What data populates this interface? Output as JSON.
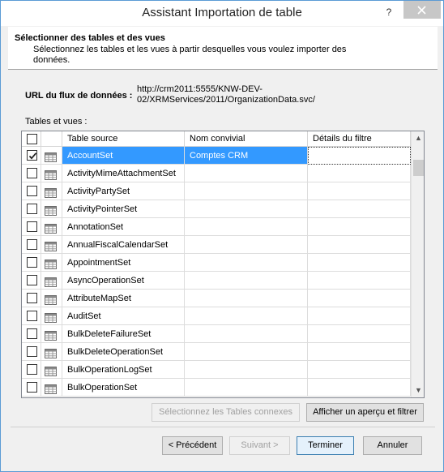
{
  "window": {
    "title": "Assistant Importation de table",
    "help_glyph": "?"
  },
  "header": {
    "title": "Sélectionner des tables et des vues",
    "description": "Sélectionnez les tables et les vues à partir desquelles vous voulez importer des données."
  },
  "url": {
    "label": "URL du flux de données :",
    "value": "http://crm2011:5555/KNW-DEV-02/XRMServices/2011/OrganizationData.svc/"
  },
  "tables": {
    "label": "Tables et vues :",
    "columns": [
      "Table source",
      "Nom convivial",
      "Détails du filtre"
    ],
    "rows": [
      {
        "source": "AccountSet",
        "friendly": "Comptes CRM",
        "filter": "",
        "checked": true,
        "selected": true
      },
      {
        "source": "ActivityMimeAttachmentSet",
        "friendly": "",
        "filter": "",
        "checked": false
      },
      {
        "source": "ActivityPartySet",
        "friendly": "",
        "filter": "",
        "checked": false
      },
      {
        "source": "ActivityPointerSet",
        "friendly": "",
        "filter": "",
        "checked": false
      },
      {
        "source": "AnnotationSet",
        "friendly": "",
        "filter": "",
        "checked": false
      },
      {
        "source": "AnnualFiscalCalendarSet",
        "friendly": "",
        "filter": "",
        "checked": false
      },
      {
        "source": "AppointmentSet",
        "friendly": "",
        "filter": "",
        "checked": false
      },
      {
        "source": "AsyncOperationSet",
        "friendly": "",
        "filter": "",
        "checked": false
      },
      {
        "source": "AttributeMapSet",
        "friendly": "",
        "filter": "",
        "checked": false
      },
      {
        "source": "AuditSet",
        "friendly": "",
        "filter": "",
        "checked": false
      },
      {
        "source": "BulkDeleteFailureSet",
        "friendly": "",
        "filter": "",
        "checked": false
      },
      {
        "source": "BulkDeleteOperationSet",
        "friendly": "",
        "filter": "",
        "checked": false
      },
      {
        "source": "BulkOperationLogSet",
        "friendly": "",
        "filter": "",
        "checked": false
      },
      {
        "source": "BulkOperationSet",
        "friendly": "",
        "filter": "",
        "checked": false
      }
    ]
  },
  "buttons": {
    "related": "Sélectionnez les Tables connexes",
    "preview": "Afficher un aperçu et filtrer",
    "previous": "< Précédent",
    "next": "Suivant >",
    "finish": "Terminer",
    "cancel": "Annuler"
  },
  "icons": {
    "close": "close-icon",
    "table": "table-icon",
    "scroll_up": "chevron-up-icon",
    "scroll_down": "chevron-down-icon"
  }
}
